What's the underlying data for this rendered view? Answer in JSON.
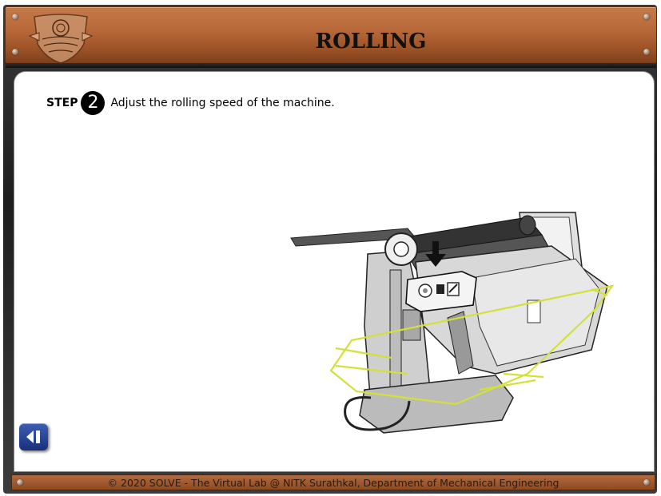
{
  "header": {
    "title": "ROLLING",
    "logo_icon": "institute-crest-logo"
  },
  "instruction": {
    "step_label": "STEP",
    "step_number": "2",
    "text": "Adjust the rolling speed of the machine."
  },
  "illustration": {
    "name": "plate-rolling-machine",
    "indicator_icon": "down-arrow-icon",
    "highlight_color": "#d4e03a"
  },
  "navigation": {
    "back_icon": "back-step-icon"
  },
  "footer": {
    "text": "© 2020 SOLVE - The Virtual Lab @ NITK Surathkal, Department of Mechanical Engineering"
  },
  "colors": {
    "header_brown": "#b8693a",
    "button_blue": "#2a4596"
  }
}
